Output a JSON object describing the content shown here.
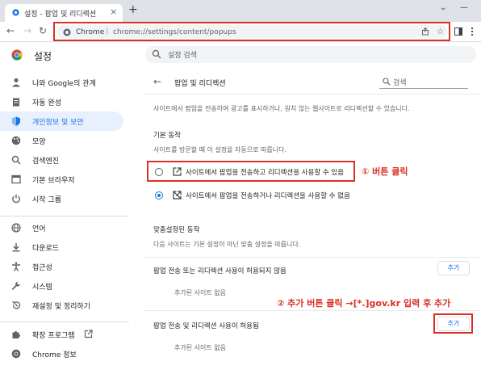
{
  "tab": {
    "title": "설정 - 팝업 및 리디렉션",
    "close": "×",
    "new_tab": "+"
  },
  "window": {
    "minimize": "—",
    "restore": "⌄"
  },
  "toolbar": {
    "back": "←",
    "forward": "→",
    "reload": "↻",
    "omnibox_site": "Chrome",
    "omnibox_sep": "|",
    "url": "chrome://settings/content/popups"
  },
  "header": {
    "title": "설정",
    "search_placeholder": "설정 검색"
  },
  "sidebar": {
    "items": [
      {
        "label": "나와 Google의 관계",
        "icon": "person-icon"
      },
      {
        "label": "자동 완성",
        "icon": "clipboard-icon"
      },
      {
        "label": "개인정보 및 보안",
        "icon": "shield-icon",
        "active": true
      },
      {
        "label": "모양",
        "icon": "palette-icon"
      },
      {
        "label": "검색엔진",
        "icon": "search-icon"
      },
      {
        "label": "기본 브라우저",
        "icon": "browser-icon"
      },
      {
        "label": "시작 그룹",
        "icon": "power-icon"
      },
      {
        "label": "언어",
        "icon": "globe-icon"
      },
      {
        "label": "다운로드",
        "icon": "download-icon"
      },
      {
        "label": "접근성",
        "icon": "accessibility-icon"
      },
      {
        "label": "시스템",
        "icon": "wrench-icon"
      },
      {
        "label": "재설정 및 정리하기",
        "icon": "reset-icon"
      },
      {
        "label": "확장 프로그램",
        "icon": "puzzle-icon"
      },
      {
        "label": "Chrome 정보",
        "icon": "chrome-icon"
      }
    ]
  },
  "main": {
    "title": "팝업 및 리디렉션",
    "search_label": "검색",
    "description": "사이트에서 팝업을 전송하여 광고를 표시하거나, 원치 않는 웹사이트로 리디렉션할 수 있습니다.",
    "default_heading": "기본 동작",
    "default_desc": "사이트를 방문할 때 이 설정을 자동으로 따릅니다.",
    "option_allow": "사이트에서 팝업을 전송하고 리디렉션을 사용할 수 있음",
    "option_block": "사이트에서 팝업을 전송하거나 리디렉션을 사용할 수 없음",
    "custom_heading": "맞춤설정된 동작",
    "custom_desc": "다음 사이트는 기본 설정이 아닌 맞춤 설정을 따릅니다.",
    "blocked_heading": "팝업 전송 또는 리디렉션 사용이 허용되지 않음",
    "blocked_empty": "추가된 사이트 없음",
    "allowed_heading": "팝업 전송 및 리디렉션 사용이 허용됨",
    "allowed_empty": "추가된 사이트 없음",
    "add_label": "추가"
  },
  "annotations": {
    "step1": "① 버튼 클릭",
    "step2": "② 추가 버튼 클릭 →[*.]gov.kr 입력 후 추가"
  },
  "colors": {
    "accent": "#1a73e8",
    "highlight": "#d93025",
    "active_bg": "#e8f0fe"
  }
}
